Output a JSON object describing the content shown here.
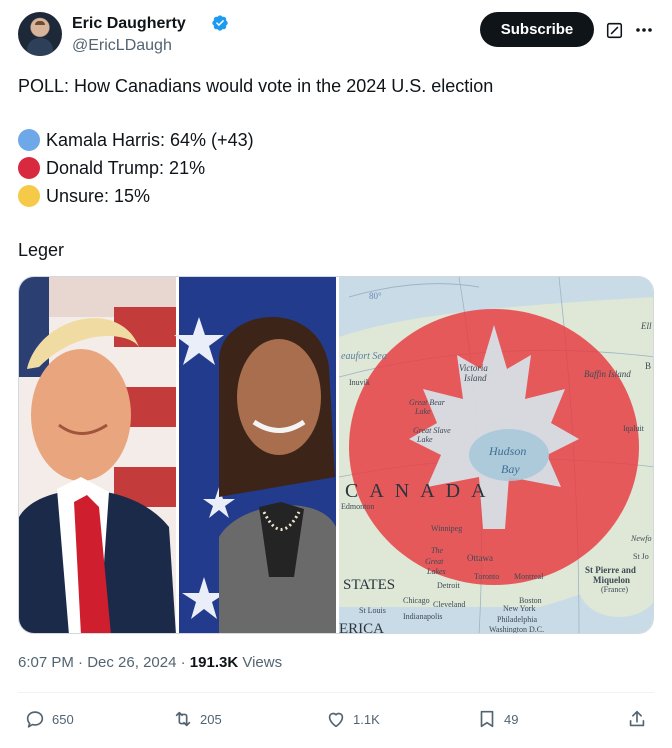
{
  "author": {
    "display_name": "Eric Daugherty",
    "handle": "@EricLDaugh"
  },
  "header": {
    "subscribe_label": "Subscribe"
  },
  "post": {
    "headline": "POLL: How Canadians would vote in the 2024 U.S. election",
    "options": [
      {
        "label": "Kamala Harris: 64% (+43)",
        "color": "#6ea8e8"
      },
      {
        "label": "Donald Trump: 21%",
        "color": "#d9293f"
      },
      {
        "label": "Unsure: 15%",
        "color": "#f7c948"
      }
    ],
    "source": "Leger"
  },
  "media": {
    "map_labels": {
      "canada": "CANADA",
      "hudson": "Hudson",
      "bay": "Bay",
      "states": "STATES",
      "erica": "ERICA",
      "beaufort": "eaufort Sea",
      "victoria": "Victoria",
      "island": "Island",
      "baffin": "Baffin Island",
      "great_bear": "Great Bear",
      "lake": "Lake",
      "great_slave": "Great Slave",
      "slave_lake": "Lake",
      "edmonton": "Edmonton",
      "winnipeg": "Winnipeg",
      "ottawa": "Ottawa",
      "toronto": "Toronto",
      "montreal": "Montreal",
      "boston": "Boston",
      "new_york": "New York",
      "philadelphia": "Philadelphia",
      "washington": "Washington D.C.",
      "chicago": "Chicago",
      "detroit": "Detroit",
      "cleveland": "Cleveland",
      "indianapolis": "Indianapolis",
      "st_louis": "St Louis",
      "st_pierre": "St Pierre and",
      "miquelon": "Miquelon",
      "france": "(France)",
      "newfo": "Newfo",
      "st_jo": "St Jo",
      "eighty": "80°",
      "inuvik": "Inuvik",
      "iqaluit": "Iqaluit",
      "the": "The",
      "great": "Great",
      "lakes": "Lakes",
      "ell": "Ell",
      "b": "B"
    }
  },
  "meta": {
    "time": "6:07 PM",
    "sep1": "·",
    "date": "Dec 26, 2024",
    "sep2": "·",
    "views_count": "191.3K",
    "views_label": "Views"
  },
  "actions": {
    "replies": "650",
    "reposts": "205",
    "likes": "1.1K",
    "bookmarks": "49"
  }
}
